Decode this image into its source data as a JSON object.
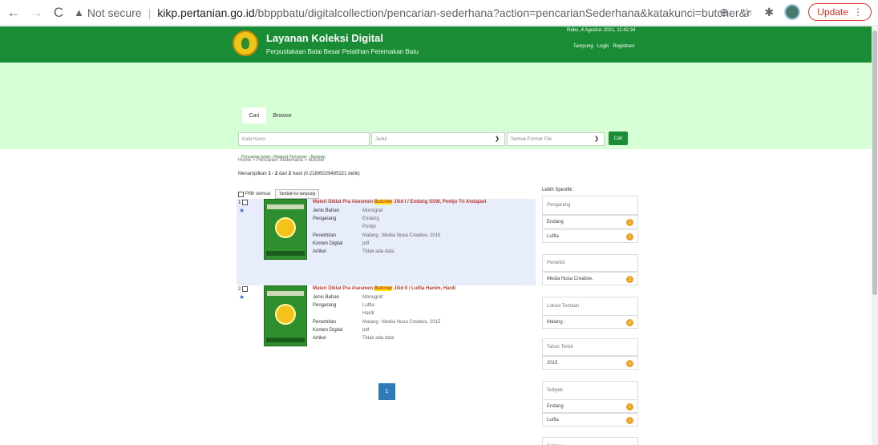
{
  "browser": {
    "back": "←",
    "forward": "→",
    "reload": "C",
    "security": "Not secure",
    "url_host": "kikp.pertanian.go.id",
    "url_path": "/bbppbatu/digitalcollection/pencarian-sederhana?action=pencarianSederhana&katakunci=butcher&ruas=Judul&bahan=Se...",
    "update_label": "Update"
  },
  "site": {
    "title": "Layanan Koleksi Digital",
    "subtitle": "Perpustakaan Balai Besar Pelatihan Peternakan Batu",
    "date": "Rabu, 4 Agustus 2021, 11:42:34",
    "links": [
      "Tampung",
      "Login",
      "Registrasi"
    ]
  },
  "search": {
    "tabs": [
      "Cari",
      "Browse"
    ],
    "keyword_placeholder": "Kata Kunci",
    "field_value": "Judul",
    "format_value": "Semua Format File",
    "button": "Cari",
    "advanced": "Pencarian lanjut - Riwayat Pencarian - Bantuan"
  },
  "breadcrumb": "Home  >  Pencarian Sederhana  >  butcher",
  "results_summary": {
    "prefix": "Menampilkan ",
    "range": "1 - 2",
    "middle": " dari ",
    "total": "2",
    "suffix": " hasil (0.21895029485321 detik)"
  },
  "select_all": "Pilih semua",
  "add_button": "Tambah ke tampung",
  "results": [
    {
      "num": "1",
      "title_pre": "Materi Diklat Pra Asesmen ",
      "title_hl": "Butcher",
      "title_post": " Jilid I / Endang SSW, Pontjo Tri Andajani",
      "labels": {
        "jenis": "Jenis Bahan",
        "pengarang": "Pengarang",
        "penerbitan": "Penerbitan",
        "konten": "Konten Digital",
        "artikel": "Artikel"
      },
      "jenis": "Monograf",
      "pengarang_1": "Endang",
      "pengarang_2": "Pontjo",
      "penerbitan": "Malang : Media Nusa Creative, 2015",
      "konten": "pdf",
      "artikel": "Tidak ada data"
    },
    {
      "num": "2",
      "title_pre": "Materi Diklat Pra Asesmen ",
      "title_hl": "Butcher",
      "title_post": " Jilid II / Lutfia Hanim, Hardi",
      "labels": {
        "jenis": "Jenis Bahan",
        "pengarang": "Pengarang",
        "penerbitan": "Penerbitan",
        "konten": "Konten Digital",
        "artikel": "Artikel"
      },
      "jenis": "Monograf",
      "pengarang_1": "Lutfia",
      "pengarang_2": "Hardi",
      "penerbitan": "Malang : Media Nusa Creative, 2015",
      "konten": "pdf",
      "artikel": "Tidak ada data"
    }
  ],
  "sidebar": {
    "heading": "Lebih Spesifik :",
    "pengarang": {
      "title": "Pengarang",
      "items": [
        {
          "label": "Endang",
          "count": "1"
        },
        {
          "label": "Lutfia",
          "count": "1"
        }
      ]
    },
    "penerbit": {
      "title": "Penerbit",
      "items": [
        {
          "label": "Media Nusa Creative,",
          "count": "2"
        }
      ]
    },
    "lokasi": {
      "title": "Lokasi Terbitan",
      "items": [
        {
          "label": "Malang :",
          "count": "2"
        }
      ]
    },
    "tahun": {
      "title": "Tahun Terbit",
      "items": [
        {
          "label": "2015",
          "count": "2"
        }
      ]
    },
    "subyek": {
      "title": "Subyek",
      "items": [
        {
          "label": "Endang",
          "count": "1"
        },
        {
          "label": "Lutfia",
          "count": "1"
        }
      ]
    },
    "bahasa": {
      "title": "Bahasa"
    }
  },
  "pagination": {
    "current": "1"
  }
}
